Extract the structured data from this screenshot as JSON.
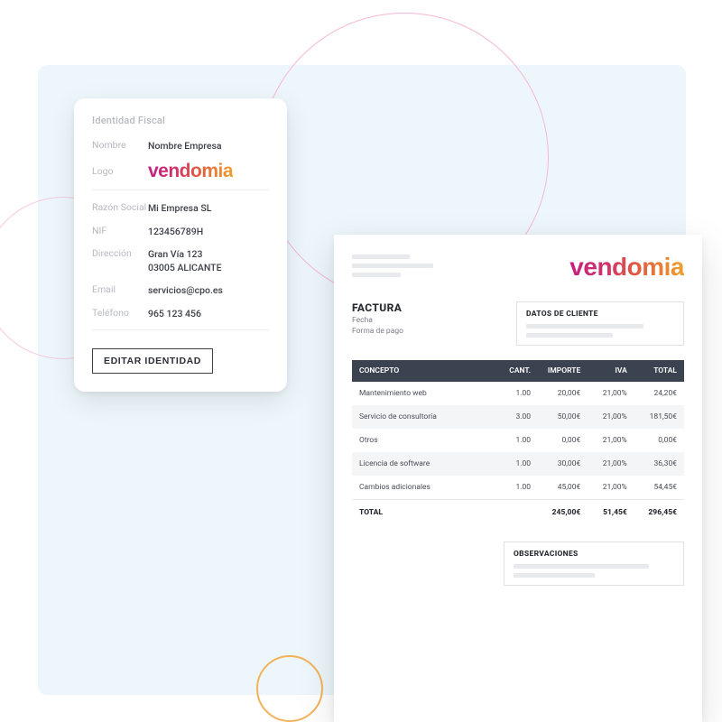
{
  "brand": "vendomia",
  "identity": {
    "title": "Identidad Fiscal",
    "labels": {
      "nombre": "Nombre",
      "logo": "Logo",
      "razon": "Razón Social",
      "nif": "NIF",
      "direccion": "Dirección",
      "email": "Email",
      "telefono": "Teléfono"
    },
    "values": {
      "nombre": "Nombre Empresa",
      "razon": "Mi Empresa SL",
      "nif": "123456789H",
      "direccion": "Gran Vía 123\n03005 ALICANTE",
      "email": "servicios@cpo.es",
      "telefono": "965 123 456"
    },
    "edit_button": "EDITAR IDENTIDAD"
  },
  "invoice": {
    "title": "FACTURA",
    "meta": {
      "fecha": "Fecha",
      "forma_pago": "Forma de pago"
    },
    "client_title": "DATOS DE CLIENTE",
    "columns": {
      "concepto": "CONCEPTO",
      "cant": "CANT.",
      "importe": "IMPORTE",
      "iva": "IVA",
      "total": "TOTAL"
    },
    "rows": [
      {
        "concepto": "Mantenimiento web",
        "cant": "1.00",
        "importe": "20,00€",
        "iva": "21,00%",
        "total": "24,20€"
      },
      {
        "concepto": "Servicio de consultoría",
        "cant": "3.00",
        "importe": "50,00€",
        "iva": "21,00%",
        "total": "181,50€"
      },
      {
        "concepto": "Otros",
        "cant": "1.00",
        "importe": "0,00€",
        "iva": "21,00%",
        "total": "0,00€"
      },
      {
        "concepto": "Licencia de software",
        "cant": "1.00",
        "importe": "30,00€",
        "iva": "21,00%",
        "total": "36,30€"
      },
      {
        "concepto": "Cambios adicionales",
        "cant": "1.00",
        "importe": "45,00€",
        "iva": "21,00%",
        "total": "54,45€"
      }
    ],
    "totals": {
      "label": "TOTAL",
      "importe": "245,00€",
      "iva": "51,45€",
      "total": "296,45€"
    },
    "obs_title": "OBSERVACIONES"
  }
}
